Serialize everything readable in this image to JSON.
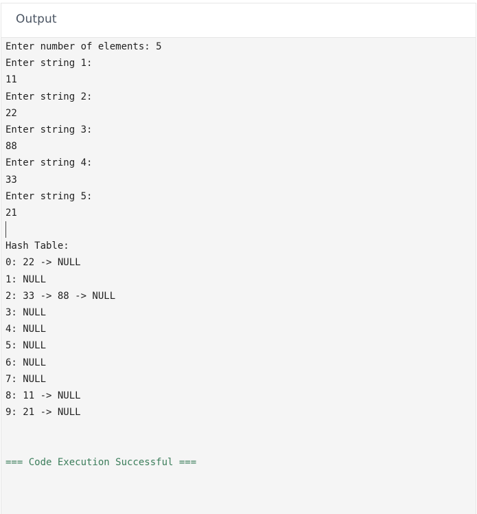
{
  "panel": {
    "title": "Output"
  },
  "console": {
    "lines": [
      "Enter number of elements: 5",
      "Enter string 1:",
      "11",
      "Enter string 2:",
      "22",
      "Enter string 3:",
      "88",
      "Enter string 4:",
      "33",
      "Enter string 5:",
      "21"
    ],
    "hash_table_lines": [
      "Hash Table:",
      "0: 22 -> NULL",
      "1: NULL",
      "2: 33 -> 88 -> NULL",
      "3: NULL",
      "4: NULL",
      "5: NULL",
      "6: NULL",
      "7: NULL",
      "8: 11 -> NULL",
      "9: 21 -> NULL"
    ],
    "status": "=== Code Execution Successful ==="
  },
  "colors": {
    "background": "#f5f5f5",
    "header_text": "#4b5563",
    "success_text": "#3b7d5a"
  }
}
